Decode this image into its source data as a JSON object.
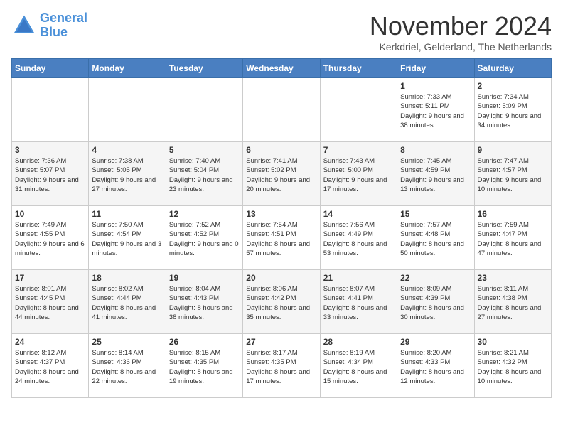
{
  "logo": {
    "line1": "General",
    "line2": "Blue"
  },
  "title": "November 2024",
  "location": "Kerkdriel, Gelderland, The Netherlands",
  "weekdays": [
    "Sunday",
    "Monday",
    "Tuesday",
    "Wednesday",
    "Thursday",
    "Friday",
    "Saturday"
  ],
  "weeks": [
    [
      {
        "day": "",
        "info": ""
      },
      {
        "day": "",
        "info": ""
      },
      {
        "day": "",
        "info": ""
      },
      {
        "day": "",
        "info": ""
      },
      {
        "day": "",
        "info": ""
      },
      {
        "day": "1",
        "info": "Sunrise: 7:33 AM\nSunset: 5:11 PM\nDaylight: 9 hours and 38 minutes."
      },
      {
        "day": "2",
        "info": "Sunrise: 7:34 AM\nSunset: 5:09 PM\nDaylight: 9 hours and 34 minutes."
      }
    ],
    [
      {
        "day": "3",
        "info": "Sunrise: 7:36 AM\nSunset: 5:07 PM\nDaylight: 9 hours and 31 minutes."
      },
      {
        "day": "4",
        "info": "Sunrise: 7:38 AM\nSunset: 5:05 PM\nDaylight: 9 hours and 27 minutes."
      },
      {
        "day": "5",
        "info": "Sunrise: 7:40 AM\nSunset: 5:04 PM\nDaylight: 9 hours and 23 minutes."
      },
      {
        "day": "6",
        "info": "Sunrise: 7:41 AM\nSunset: 5:02 PM\nDaylight: 9 hours and 20 minutes."
      },
      {
        "day": "7",
        "info": "Sunrise: 7:43 AM\nSunset: 5:00 PM\nDaylight: 9 hours and 17 minutes."
      },
      {
        "day": "8",
        "info": "Sunrise: 7:45 AM\nSunset: 4:59 PM\nDaylight: 9 hours and 13 minutes."
      },
      {
        "day": "9",
        "info": "Sunrise: 7:47 AM\nSunset: 4:57 PM\nDaylight: 9 hours and 10 minutes."
      }
    ],
    [
      {
        "day": "10",
        "info": "Sunrise: 7:49 AM\nSunset: 4:55 PM\nDaylight: 9 hours and 6 minutes."
      },
      {
        "day": "11",
        "info": "Sunrise: 7:50 AM\nSunset: 4:54 PM\nDaylight: 9 hours and 3 minutes."
      },
      {
        "day": "12",
        "info": "Sunrise: 7:52 AM\nSunset: 4:52 PM\nDaylight: 9 hours and 0 minutes."
      },
      {
        "day": "13",
        "info": "Sunrise: 7:54 AM\nSunset: 4:51 PM\nDaylight: 8 hours and 57 minutes."
      },
      {
        "day": "14",
        "info": "Sunrise: 7:56 AM\nSunset: 4:49 PM\nDaylight: 8 hours and 53 minutes."
      },
      {
        "day": "15",
        "info": "Sunrise: 7:57 AM\nSunset: 4:48 PM\nDaylight: 8 hours and 50 minutes."
      },
      {
        "day": "16",
        "info": "Sunrise: 7:59 AM\nSunset: 4:47 PM\nDaylight: 8 hours and 47 minutes."
      }
    ],
    [
      {
        "day": "17",
        "info": "Sunrise: 8:01 AM\nSunset: 4:45 PM\nDaylight: 8 hours and 44 minutes."
      },
      {
        "day": "18",
        "info": "Sunrise: 8:02 AM\nSunset: 4:44 PM\nDaylight: 8 hours and 41 minutes."
      },
      {
        "day": "19",
        "info": "Sunrise: 8:04 AM\nSunset: 4:43 PM\nDaylight: 8 hours and 38 minutes."
      },
      {
        "day": "20",
        "info": "Sunrise: 8:06 AM\nSunset: 4:42 PM\nDaylight: 8 hours and 35 minutes."
      },
      {
        "day": "21",
        "info": "Sunrise: 8:07 AM\nSunset: 4:41 PM\nDaylight: 8 hours and 33 minutes."
      },
      {
        "day": "22",
        "info": "Sunrise: 8:09 AM\nSunset: 4:39 PM\nDaylight: 8 hours and 30 minutes."
      },
      {
        "day": "23",
        "info": "Sunrise: 8:11 AM\nSunset: 4:38 PM\nDaylight: 8 hours and 27 minutes."
      }
    ],
    [
      {
        "day": "24",
        "info": "Sunrise: 8:12 AM\nSunset: 4:37 PM\nDaylight: 8 hours and 24 minutes."
      },
      {
        "day": "25",
        "info": "Sunrise: 8:14 AM\nSunset: 4:36 PM\nDaylight: 8 hours and 22 minutes."
      },
      {
        "day": "26",
        "info": "Sunrise: 8:15 AM\nSunset: 4:35 PM\nDaylight: 8 hours and 19 minutes."
      },
      {
        "day": "27",
        "info": "Sunrise: 8:17 AM\nSunset: 4:35 PM\nDaylight: 8 hours and 17 minutes."
      },
      {
        "day": "28",
        "info": "Sunrise: 8:19 AM\nSunset: 4:34 PM\nDaylight: 8 hours and 15 minutes."
      },
      {
        "day": "29",
        "info": "Sunrise: 8:20 AM\nSunset: 4:33 PM\nDaylight: 8 hours and 12 minutes."
      },
      {
        "day": "30",
        "info": "Sunrise: 8:21 AM\nSunset: 4:32 PM\nDaylight: 8 hours and 10 minutes."
      }
    ]
  ]
}
